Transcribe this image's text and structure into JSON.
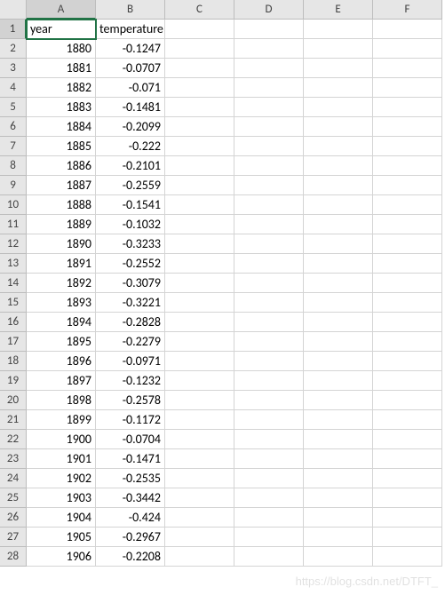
{
  "columns": [
    "A",
    "B",
    "C",
    "D",
    "E",
    "F"
  ],
  "headers": {
    "A": "year",
    "B": "temperature"
  },
  "selected": {
    "col": "A",
    "row": 1
  },
  "rows": [
    {
      "n": 1,
      "A": "year",
      "B": "temperature"
    },
    {
      "n": 2,
      "A": "1880",
      "B": "-0.1247"
    },
    {
      "n": 3,
      "A": "1881",
      "B": "-0.0707"
    },
    {
      "n": 4,
      "A": "1882",
      "B": "-0.071"
    },
    {
      "n": 5,
      "A": "1883",
      "B": "-0.1481"
    },
    {
      "n": 6,
      "A": "1884",
      "B": "-0.2099"
    },
    {
      "n": 7,
      "A": "1885",
      "B": "-0.222"
    },
    {
      "n": 8,
      "A": "1886",
      "B": "-0.2101"
    },
    {
      "n": 9,
      "A": "1887",
      "B": "-0.2559"
    },
    {
      "n": 10,
      "A": "1888",
      "B": "-0.1541"
    },
    {
      "n": 11,
      "A": "1889",
      "B": "-0.1032"
    },
    {
      "n": 12,
      "A": "1890",
      "B": "-0.3233"
    },
    {
      "n": 13,
      "A": "1891",
      "B": "-0.2552"
    },
    {
      "n": 14,
      "A": "1892",
      "B": "-0.3079"
    },
    {
      "n": 15,
      "A": "1893",
      "B": "-0.3221"
    },
    {
      "n": 16,
      "A": "1894",
      "B": "-0.2828"
    },
    {
      "n": 17,
      "A": "1895",
      "B": "-0.2279"
    },
    {
      "n": 18,
      "A": "1896",
      "B": "-0.0971"
    },
    {
      "n": 19,
      "A": "1897",
      "B": "-0.1232"
    },
    {
      "n": 20,
      "A": "1898",
      "B": "-0.2578"
    },
    {
      "n": 21,
      "A": "1899",
      "B": "-0.1172"
    },
    {
      "n": 22,
      "A": "1900",
      "B": "-0.0704"
    },
    {
      "n": 23,
      "A": "1901",
      "B": "-0.1471"
    },
    {
      "n": 24,
      "A": "1902",
      "B": "-0.2535"
    },
    {
      "n": 25,
      "A": "1903",
      "B": "-0.3442"
    },
    {
      "n": 26,
      "A": "1904",
      "B": "-0.424"
    },
    {
      "n": 27,
      "A": "1905",
      "B": "-0.2967"
    },
    {
      "n": 28,
      "A": "1906",
      "B": "-0.2208"
    }
  ],
  "watermark": "https://blog.csdn.net/DTFT_"
}
